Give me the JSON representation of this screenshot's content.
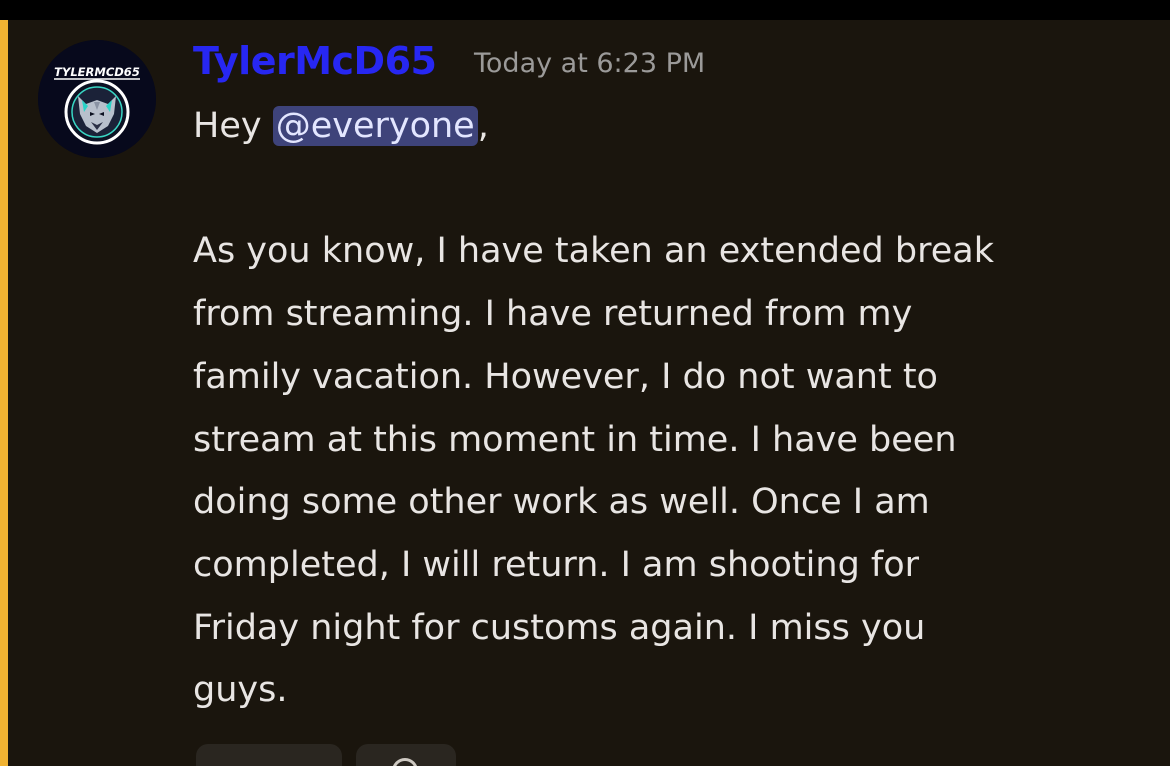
{
  "message": {
    "author": "TylerMcD65",
    "timestamp": "Today at 6:23 PM",
    "greeting_prefix": "Hey ",
    "mention": "@everyone",
    "greeting_suffix": ",",
    "lines": [
      "As you know, I have taken an extended break",
      "from streaming. I have returned from my",
      "family vacation. However, I do not want to",
      "stream at this moment in time. I have been",
      "doing some other work as well. Once I am",
      "completed, I will return. I am shooting for",
      "Friday night for customs again. I miss you",
      "guys."
    ]
  },
  "avatar": {
    "logo_text": "TYLERMCD65",
    "icon": "wolf-logo-icon"
  },
  "colors": {
    "background": "#1a150d",
    "username": "#2727f2",
    "mention_bg": "#3e437a",
    "highlight_bar": "#f0b232",
    "text": "#e8e5e3",
    "timestamp": "#9b9a99"
  },
  "reactions": [
    {
      "icon": "reaction-pill"
    },
    {
      "icon": "add-reaction-icon"
    }
  ]
}
